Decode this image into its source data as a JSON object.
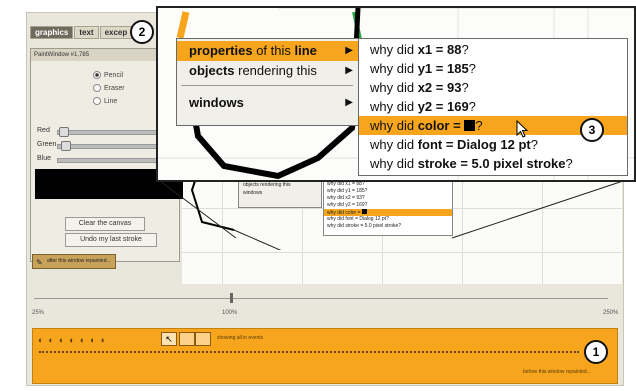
{
  "tabs": [
    "graphics",
    "text",
    "excep"
  ],
  "paint_window": {
    "title": "PaintWindow #1,785",
    "tools": [
      "Pencil",
      "Eraser",
      "Line"
    ],
    "selected_tool": "Pencil",
    "sliders": [
      "Red",
      "Green",
      "Blue"
    ],
    "buttons": [
      "Clear the canvas",
      "Undo my last stroke"
    ],
    "after_repaint": "after this window repainted..."
  },
  "timeline": {
    "left_label": "25%",
    "mid_label": "100%",
    "right_label": "250%"
  },
  "strip": {
    "events_label": "showing all in events",
    "status": "before this window repainted..."
  },
  "menu": {
    "items": [
      {
        "bold": "properties",
        "rest": " of this ",
        "bold2": "line"
      },
      {
        "bold": "objects",
        "rest": " rendering this",
        "bold2": ""
      },
      {
        "bold": "windows",
        "rest": "",
        "bold2": ""
      }
    ]
  },
  "submenu": {
    "items": [
      {
        "pre": "why did ",
        "key": "x1 = 88",
        "post": "?"
      },
      {
        "pre": "why did ",
        "key": "y1 = 185",
        "post": "?"
      },
      {
        "pre": "why did ",
        "key": "x2 = 93",
        "post": "?"
      },
      {
        "pre": "why did ",
        "key": "y2 = 169",
        "post": "?"
      },
      {
        "pre": "why did ",
        "key": "color = ",
        "post": "?"
      },
      {
        "pre": "why did ",
        "key": "font = Dialog 12 pt",
        "post": "?"
      },
      {
        "pre": "why did ",
        "key": "stroke = 5.0 pixel stroke",
        "post": "?"
      }
    ],
    "highlighted_index": 4
  },
  "small_menu": {
    "items": [
      "objects rendering this",
      "windows"
    ],
    "sub": [
      "why did x1 = 88?",
      "why did y1 = 185?",
      "why did x2 = 93?",
      "why did y2 = 169?",
      "why did color = ",
      "why did font = Dialog 12 pt?",
      "why did stroke = 5.0 pixel stroke?"
    ]
  },
  "badges": [
    "1",
    "2",
    "3"
  ],
  "colors": {
    "accent": "#f6a51d",
    "line_green": "#2aa84a",
    "stroke": "#000000"
  },
  "icons": [
    "cursor-icon",
    "submenu-arrow-icon",
    "pencil-icon",
    "event-marker-icon"
  ]
}
